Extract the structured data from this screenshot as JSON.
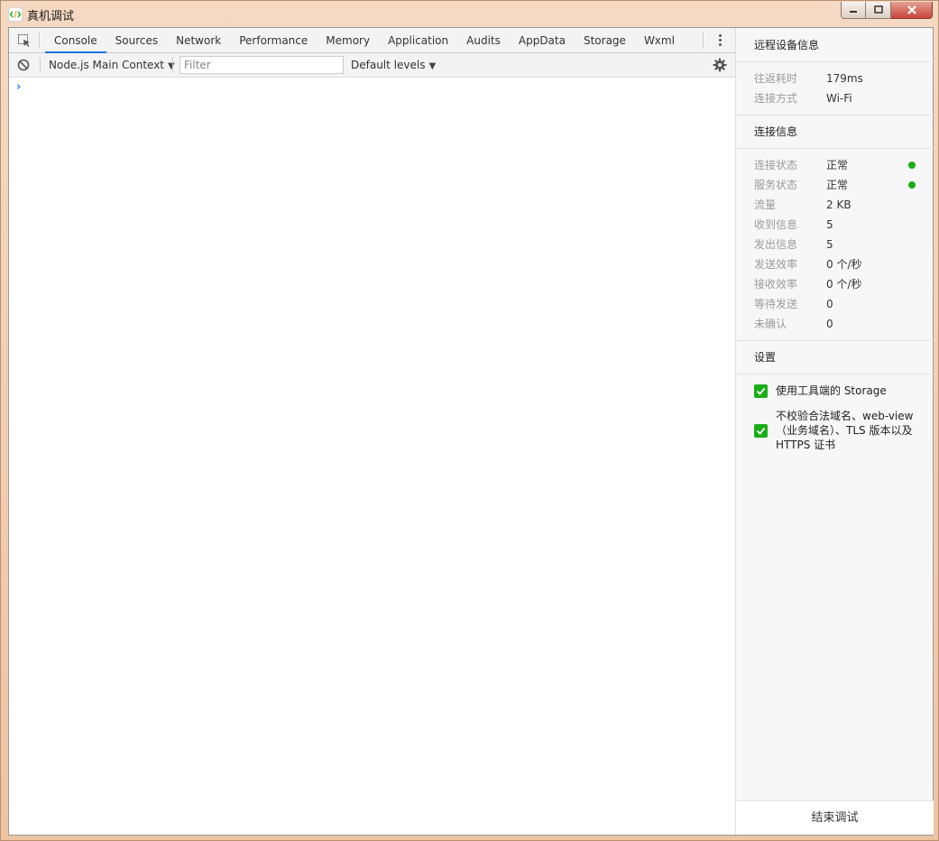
{
  "window": {
    "title": "真机调试"
  },
  "devtools": {
    "tabs": [
      {
        "label": "Console",
        "active": true
      },
      {
        "label": "Sources",
        "active": false
      },
      {
        "label": "Network",
        "active": false
      },
      {
        "label": "Performance",
        "active": false
      },
      {
        "label": "Memory",
        "active": false
      },
      {
        "label": "Application",
        "active": false
      },
      {
        "label": "Audits",
        "active": false
      },
      {
        "label": "AppData",
        "active": false
      },
      {
        "label": "Storage",
        "active": false
      },
      {
        "label": "Wxml",
        "active": false
      }
    ],
    "toolbar": {
      "context": "Node.js Main Context",
      "filter_placeholder": "Filter",
      "levels": "Default levels"
    },
    "console_prompt": "›"
  },
  "panel": {
    "remote_device": {
      "title": "远程设备信息",
      "rows": [
        {
          "label": "往返耗时",
          "value": "179ms"
        },
        {
          "label": "连接方式",
          "value": "Wi-Fi"
        }
      ]
    },
    "connection": {
      "title": "连接信息",
      "rows": [
        {
          "label": "连接状态",
          "value": "正常",
          "status": "ok"
        },
        {
          "label": "服务状态",
          "value": "正常",
          "status": "ok"
        },
        {
          "label": "流量",
          "value": "2 KB"
        },
        {
          "label": "收到信息",
          "value": "5"
        },
        {
          "label": "发出信息",
          "value": "5"
        },
        {
          "label": "发送效率",
          "value": "0 个/秒"
        },
        {
          "label": "接收效率",
          "value": "0 个/秒"
        },
        {
          "label": "等待发送",
          "value": "0"
        },
        {
          "label": "未确认",
          "value": "0"
        }
      ]
    },
    "settings": {
      "title": "设置",
      "options": [
        {
          "label": "使用工具端的 Storage",
          "checked": true
        },
        {
          "label": "不校验合法域名、web-view（业务域名）、TLS 版本以及 HTTPS 证书",
          "checked": true
        }
      ]
    },
    "end_button": "结束调试"
  },
  "colors": {
    "accent_green": "#1aad19",
    "tab_active_underline": "#1a73e8",
    "prompt_blue": "#367cf1"
  }
}
